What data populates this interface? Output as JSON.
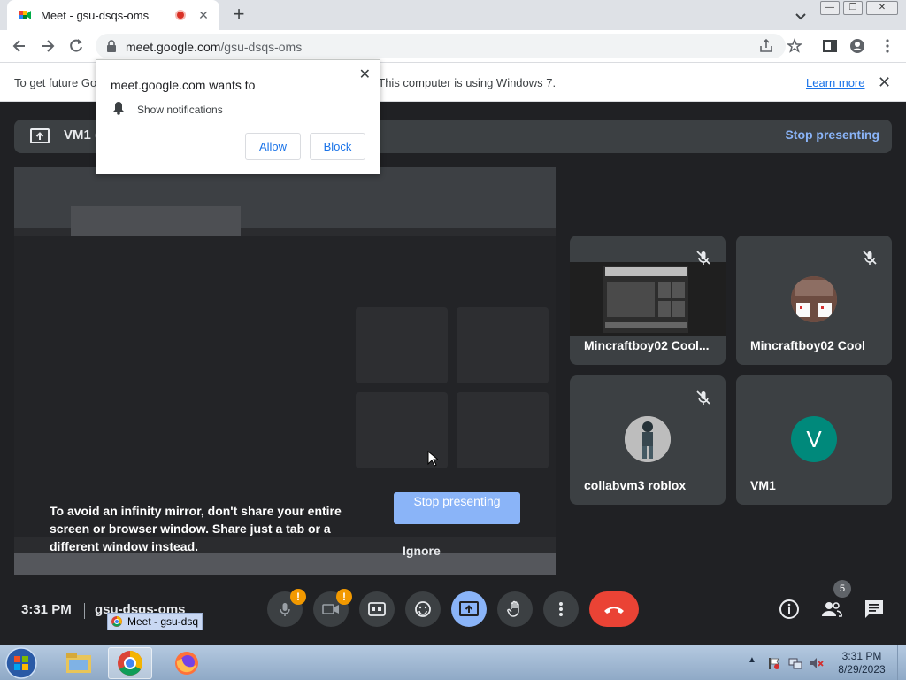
{
  "browser": {
    "tab_title": "Meet - gsu-dsqs-oms",
    "tab_close": "✕",
    "new_tab": "+",
    "url_host": "meet.google.com",
    "url_path": "/gsu-dsqs-oms",
    "window_controls": [
      "—",
      "❐",
      "✕"
    ]
  },
  "infobar": {
    "text": "To get future Google Chrome updates, you'll need Windows 10 or later. This computer is using Windows 7.",
    "link": "Learn more",
    "close": "✕"
  },
  "permission_popup": {
    "title": "meet.google.com wants to",
    "item": "Show notifications",
    "allow": "Allow",
    "block": "Block",
    "close": "✕"
  },
  "meet": {
    "banner_title": "VM1 (You, presenting)",
    "banner_stop": "Stop presenting",
    "warning_text": "To avoid an infinity mirror, don't share your entire screen or browser window. Share just a tab or a different window instead.",
    "stop_button": "Stop presenting",
    "ignore_button": "Ignore",
    "participants": [
      {
        "name": "Mincraftboy02 Cool...",
        "muted": true
      },
      {
        "name": "Mincraftboy02 Cool",
        "muted": true
      },
      {
        "name": "collabvm3 roblox",
        "muted": true
      },
      {
        "name": "VM1",
        "muted": false,
        "initial": "V",
        "color": "#00897b"
      }
    ],
    "time": "3:31 PM",
    "meeting_code": "gsu-dsqs-oms",
    "mic_warning": "!",
    "cam_warning": "!",
    "people_count": "5",
    "tooltip": "Meet - gsu-dsq"
  },
  "taskbar": {
    "clock_time": "3:31 PM",
    "clock_date": "8/29/2023",
    "tray_arrow": "▲"
  },
  "colors": {
    "meet_bg": "#202124",
    "accent_blue": "#8ab4f8",
    "end_call_red": "#ea4335",
    "warning_orange": "#f29900"
  }
}
